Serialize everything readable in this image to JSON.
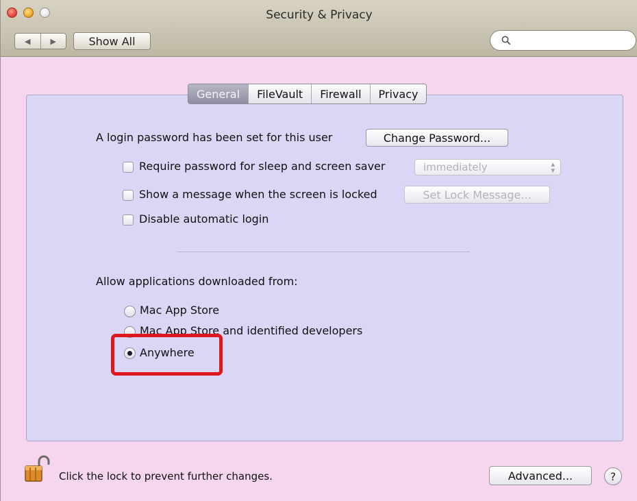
{
  "window": {
    "title": "Security & Privacy"
  },
  "toolbar": {
    "back_glyph": "◀",
    "forward_glyph": "▶",
    "show_all_label": "Show All",
    "search_icon": "search-icon",
    "search_placeholder": ""
  },
  "tabs": [
    {
      "label": "General",
      "selected": true
    },
    {
      "label": "FileVault",
      "selected": false
    },
    {
      "label": "Firewall",
      "selected": false
    },
    {
      "label": "Privacy",
      "selected": false
    }
  ],
  "general": {
    "login_password_text": "A login password has been set for this user",
    "change_password_label": "Change Password...",
    "require_password_label": "Require password for sleep and screen saver",
    "require_password_checked": false,
    "require_password_delay": "immediately",
    "show_message_label": "Show a message when the screen is locked",
    "show_message_checked": false,
    "set_lock_message_label": "Set Lock Message...",
    "disable_autologin_label": "Disable automatic login",
    "disable_autologin_checked": false
  },
  "gatekeeper": {
    "heading": "Allow applications downloaded from:",
    "options": [
      {
        "label": "Mac App Store",
        "selected": false
      },
      {
        "label": "Mac App Store and identified developers",
        "selected": false
      },
      {
        "label": "Anywhere",
        "selected": true
      }
    ],
    "highlight_color": "#e0161d"
  },
  "footer": {
    "lock_text": "Click the lock to prevent further changes.",
    "advanced_label": "Advanced...",
    "help_label": "?"
  },
  "colors": {
    "window_bg": "#f6d6ee",
    "pane_bg": "#d9d6f6",
    "active_tab": "#9f9eb2"
  }
}
